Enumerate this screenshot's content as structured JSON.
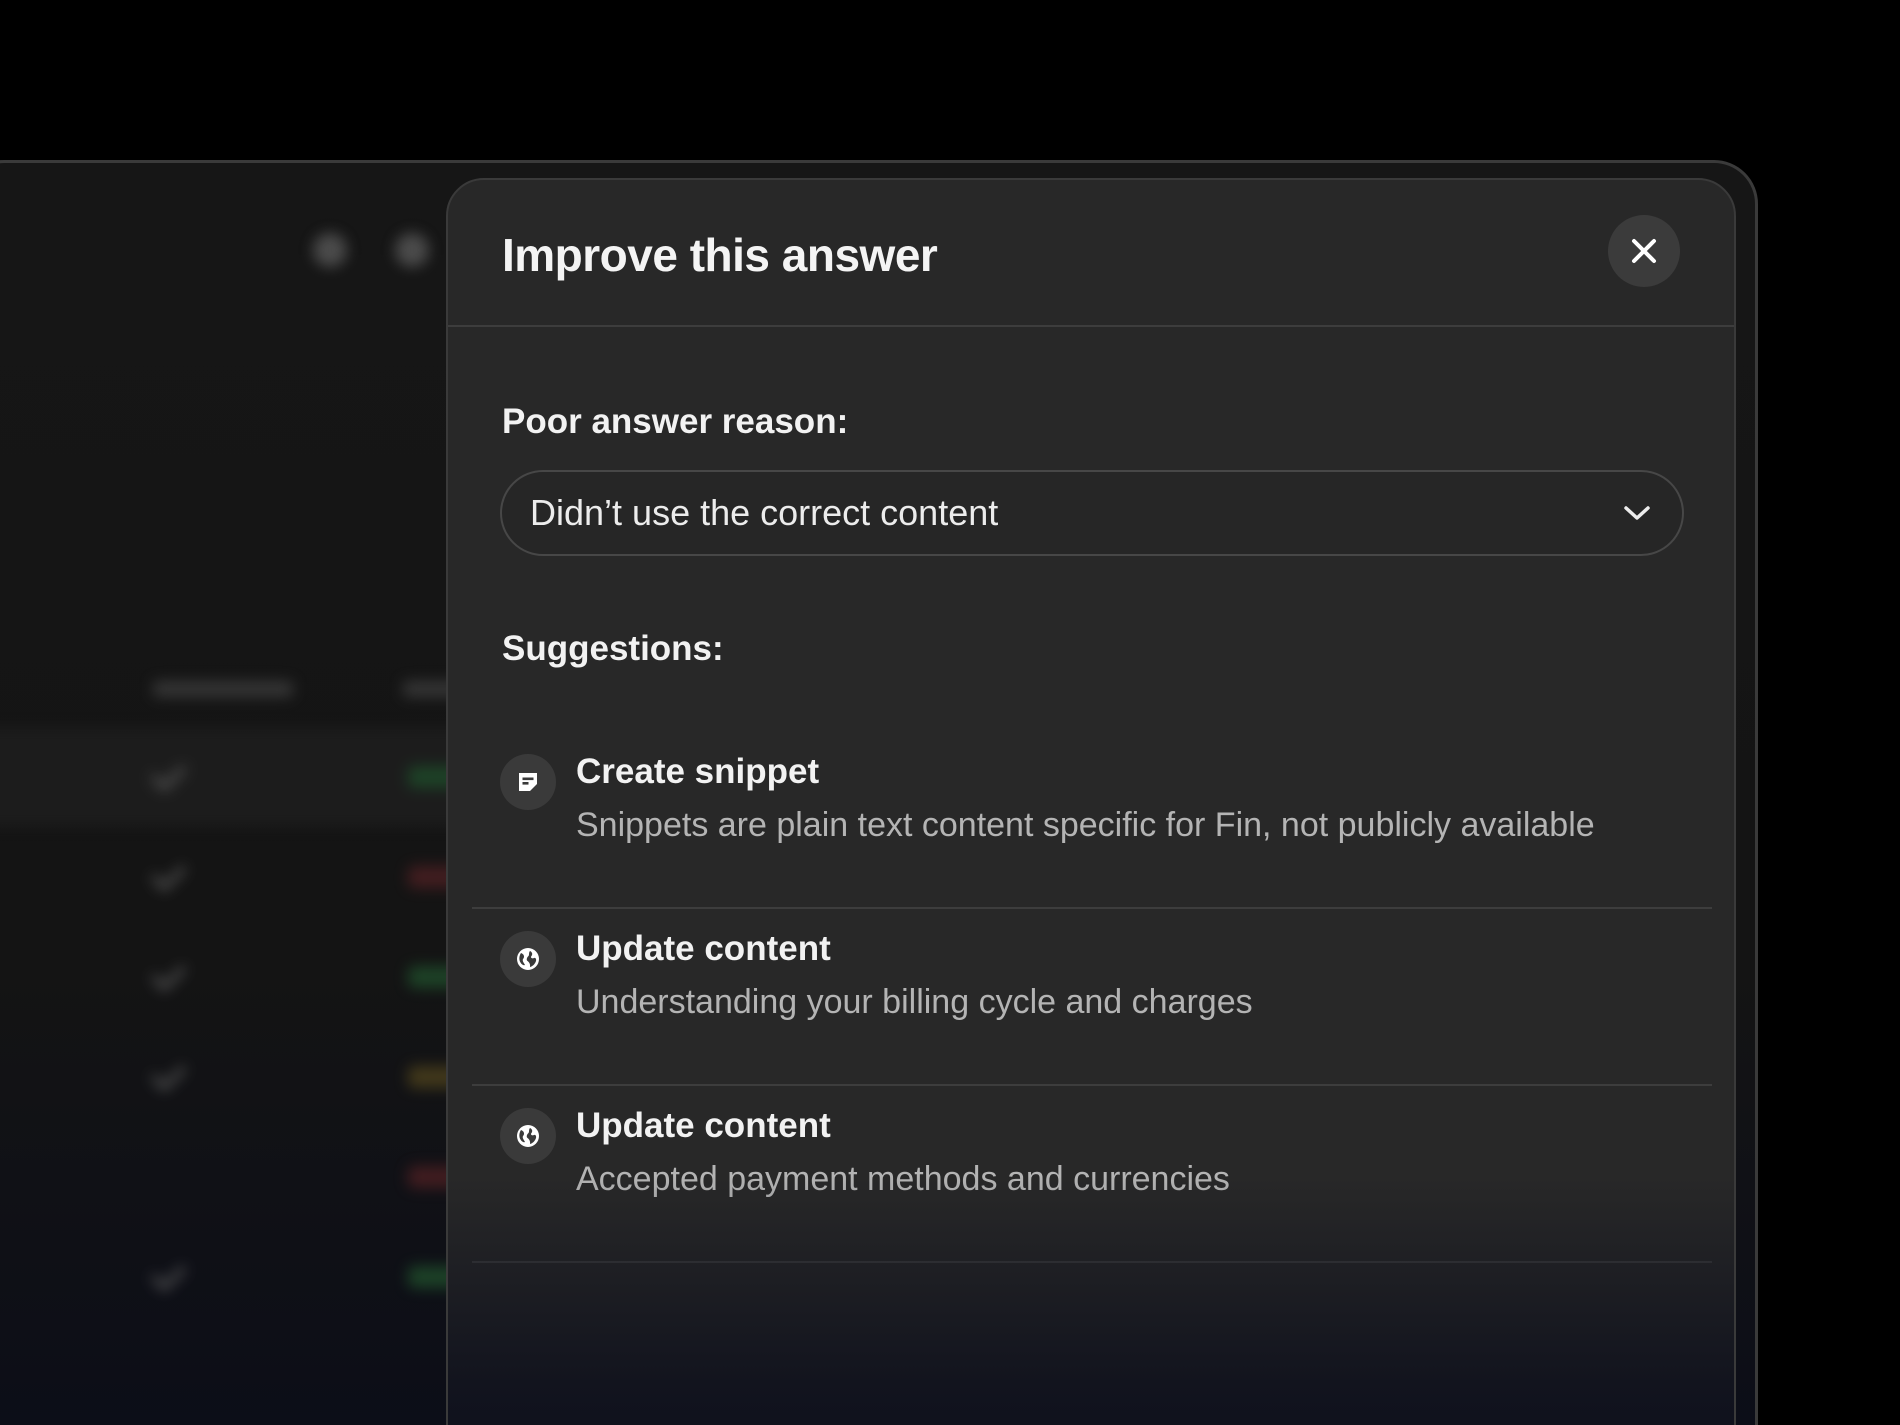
{
  "modal": {
    "title": "Improve this answer",
    "close_icon": "close-icon",
    "reason_label": "Poor answer reason:",
    "reason_select": {
      "value": "Didn’t use the correct content",
      "icon": "chevron-down-icon"
    },
    "suggestions_label": "Suggestions:",
    "suggestions": [
      {
        "icon": "snippet-icon",
        "title": "Create snippet",
        "description": "Snippets are plain text content specific for Fin, not publicly available"
      },
      {
        "icon": "globe-icon",
        "title": "Update content",
        "description": "Understanding your billing cycle and charges"
      },
      {
        "icon": "globe-icon",
        "title": "Update content",
        "description": "Accepted payment methods and currencies"
      }
    ]
  },
  "colors": {
    "page_background": "#000000",
    "modal_background": "#282828",
    "border": "#3d3d3d",
    "text_primary": "#f2f2f2",
    "text_secondary": "#b4b4b4",
    "icon_background": "#3a3a3a"
  }
}
